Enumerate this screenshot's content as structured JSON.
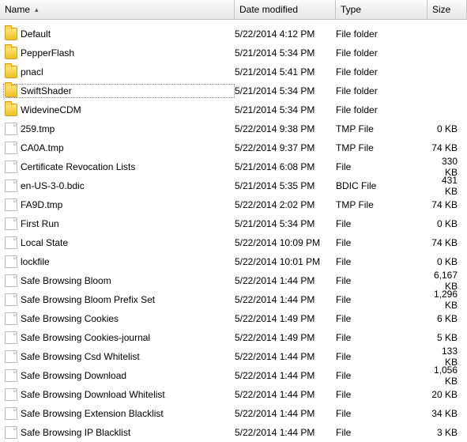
{
  "columns": {
    "name": "Name",
    "date": "Date modified",
    "type": "Type",
    "size": "Size"
  },
  "sort_indicator": "▴",
  "selected_index": 3,
  "items": [
    {
      "icon": "folder",
      "name": "Default",
      "date": "5/22/2014 4:12 PM",
      "type": "File folder",
      "size": ""
    },
    {
      "icon": "folder",
      "name": "PepperFlash",
      "date": "5/21/2014 5:34 PM",
      "type": "File folder",
      "size": ""
    },
    {
      "icon": "folder",
      "name": "pnacl",
      "date": "5/21/2014 5:41 PM",
      "type": "File folder",
      "size": ""
    },
    {
      "icon": "folder",
      "name": "SwiftShader",
      "date": "5/21/2014 5:34 PM",
      "type": "File folder",
      "size": ""
    },
    {
      "icon": "folder",
      "name": "WidevineCDM",
      "date": "5/21/2014 5:34 PM",
      "type": "File folder",
      "size": ""
    },
    {
      "icon": "file",
      "name": "259.tmp",
      "date": "5/22/2014 9:38 PM",
      "type": "TMP File",
      "size": "0 KB"
    },
    {
      "icon": "file",
      "name": "CA0A.tmp",
      "date": "5/22/2014 9:37 PM",
      "type": "TMP File",
      "size": "74 KB"
    },
    {
      "icon": "file",
      "name": "Certificate Revocation Lists",
      "date": "5/21/2014 6:08 PM",
      "type": "File",
      "size": "330 KB"
    },
    {
      "icon": "file",
      "name": "en-US-3-0.bdic",
      "date": "5/21/2014 5:35 PM",
      "type": "BDIC File",
      "size": "431 KB"
    },
    {
      "icon": "file",
      "name": "FA9D.tmp",
      "date": "5/22/2014 2:02 PM",
      "type": "TMP File",
      "size": "74 KB"
    },
    {
      "icon": "file",
      "name": "First Run",
      "date": "5/21/2014 5:34 PM",
      "type": "File",
      "size": "0 KB"
    },
    {
      "icon": "file",
      "name": "Local State",
      "date": "5/22/2014 10:09 PM",
      "type": "File",
      "size": "74 KB"
    },
    {
      "icon": "file",
      "name": "lockfile",
      "date": "5/22/2014 10:01 PM",
      "type": "File",
      "size": "0 KB"
    },
    {
      "icon": "file",
      "name": "Safe Browsing Bloom",
      "date": "5/22/2014 1:44 PM",
      "type": "File",
      "size": "6,167 KB"
    },
    {
      "icon": "file",
      "name": "Safe Browsing Bloom Prefix Set",
      "date": "5/22/2014 1:44 PM",
      "type": "File",
      "size": "1,296 KB"
    },
    {
      "icon": "file",
      "name": "Safe Browsing Cookies",
      "date": "5/22/2014 1:49 PM",
      "type": "File",
      "size": "6 KB"
    },
    {
      "icon": "file",
      "name": "Safe Browsing Cookies-journal",
      "date": "5/22/2014 1:49 PM",
      "type": "File",
      "size": "5 KB"
    },
    {
      "icon": "file",
      "name": "Safe Browsing Csd Whitelist",
      "date": "5/22/2014 1:44 PM",
      "type": "File",
      "size": "133 KB"
    },
    {
      "icon": "file",
      "name": "Safe Browsing Download",
      "date": "5/22/2014 1:44 PM",
      "type": "File",
      "size": "1,056 KB"
    },
    {
      "icon": "file",
      "name": "Safe Browsing Download Whitelist",
      "date": "5/22/2014 1:44 PM",
      "type": "File",
      "size": "20 KB"
    },
    {
      "icon": "file",
      "name": "Safe Browsing Extension Blacklist",
      "date": "5/22/2014 1:44 PM",
      "type": "File",
      "size": "34 KB"
    },
    {
      "icon": "file",
      "name": "Safe Browsing IP Blacklist",
      "date": "5/22/2014 1:44 PM",
      "type": "File",
      "size": "3 KB"
    }
  ]
}
